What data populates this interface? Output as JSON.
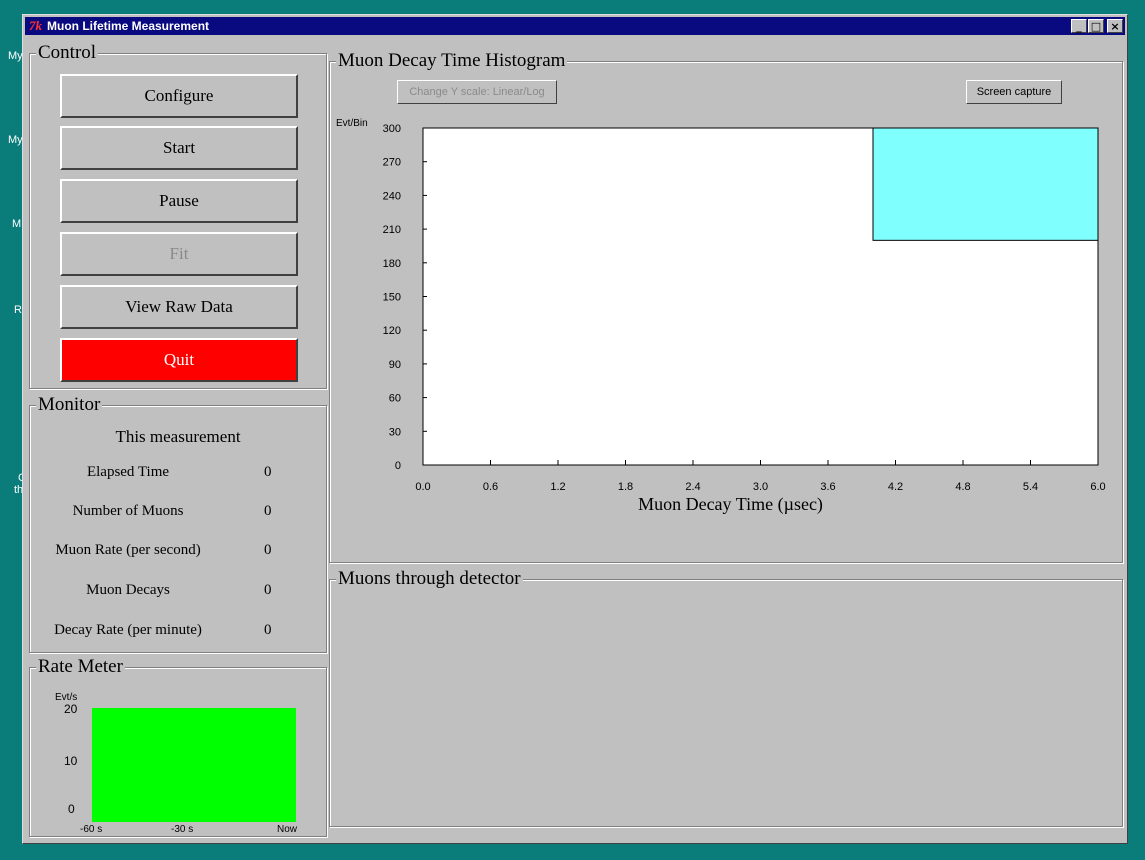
{
  "desktop": {
    "labels": [
      "My",
      "My",
      "M",
      "R",
      "C",
      "th"
    ]
  },
  "window": {
    "title": "Muon Lifetime Measurement",
    "controls": [
      "_",
      "□",
      "×"
    ]
  },
  "control": {
    "title": "Control",
    "buttons": {
      "configure": "Configure",
      "start": "Start",
      "pause": "Pause",
      "fit": "Fit",
      "view_raw": "View Raw Data",
      "quit": "Quit"
    }
  },
  "monitor": {
    "title": "Monitor",
    "heading": "This measurement",
    "rows": [
      {
        "label": "Elapsed Time",
        "value": "0"
      },
      {
        "label": "Number of Muons",
        "value": "0"
      },
      {
        "label": "Muon Rate (per second)",
        "value": "0"
      },
      {
        "label": "Muon Decays",
        "value": "0"
      },
      {
        "label": "Decay Rate (per minute)",
        "value": "0"
      }
    ]
  },
  "rate_meter": {
    "title": "Rate Meter",
    "ylabel": "Evt/s",
    "yticks": [
      "20",
      "10",
      "0"
    ],
    "xticks": [
      "-60 s",
      "-30 s",
      "Now"
    ],
    "fill_color": "#00ff00"
  },
  "histogram": {
    "title": "Muon Decay Time Histogram",
    "scale_button": "Change Y scale: Linear/Log",
    "capture_button": "Screen capture",
    "chart_data": {
      "type": "bar",
      "title": "",
      "xlabel": "Muon Decay Time (µsec)",
      "ylabel": "Evt/Bin",
      "xlim": [
        0.0,
        6.0
      ],
      "ylim": [
        0,
        300
      ],
      "xticks": [
        "0.0",
        "0.6",
        "1.2",
        "1.8",
        "2.4",
        "3.0",
        "3.6",
        "4.2",
        "4.8",
        "5.4",
        "6.0"
      ],
      "yticks": [
        "300",
        "270",
        "240",
        "210",
        "180",
        "150",
        "120",
        "90",
        "60",
        "30",
        "0"
      ],
      "highlight": {
        "x0": 4.0,
        "x1": 6.0,
        "y0": 200,
        "y1": 300,
        "color": "#80ffff"
      }
    }
  },
  "detector": {
    "title": "Muons through detector"
  }
}
